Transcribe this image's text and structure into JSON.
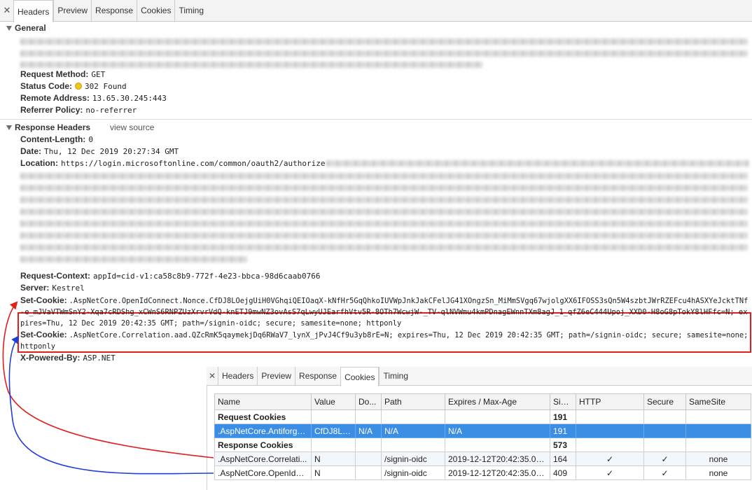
{
  "tabs": [
    "Headers",
    "Preview",
    "Response",
    "Cookies",
    "Timing"
  ],
  "general": {
    "title": "General",
    "rows": [
      {
        "key": "Request Method:",
        "value": "GET"
      },
      {
        "key": "Status Code:",
        "value": "302 Found"
      },
      {
        "key": "Remote Address:",
        "value": "13.65.30.245:443"
      },
      {
        "key": "Referrer Policy:",
        "value": "no-referrer"
      }
    ]
  },
  "response_headers": {
    "title": "Response Headers",
    "view_source": "view source",
    "content_length": {
      "key": "Content-Length:",
      "value": "0"
    },
    "date": {
      "key": "Date:",
      "value": "Thu, 12 Dec 2019 20:27:34 GMT"
    },
    "location": {
      "key": "Location:",
      "value": "https://login.microsoftonline.com/common/oauth2/authorize"
    },
    "request_context": {
      "key": "Request-Context:",
      "value": "appId=cid-v1:ca58c8b9-772f-4e23-bbca-98d6caab0766"
    },
    "server": {
      "key": "Server:",
      "value": "Kestrel"
    },
    "set_cookie_1": {
      "key": "Set-Cookie:",
      "value": ".AspNetCore.OpenIdConnect.Nonce.CfDJ8LOejgUiH0VGhqiQEIOaqX-kNfHr5GqQhkoIUVWpJnkJakCFelJG41XOngzSn_MiMmSVgq67wjolgXX6IFOSS3sQn5W4szbtJWrRZEFcu4hASXYeJcktTNf-e_mJVaVTWmSnY2-Xqa7cRDShg_xCWnS6RNPZUzXrvrVdQ-knETJ9mwNZ3ovAsS7qLwyUJEarfhVtv5R-8OTh7WcwjW-_TV-qlNVWmu4kmPDnagEWnnTXm8agJ_1_qfZ6eC444Upoj_XXD0-H8oG8pTokY8lHFfc=N; expires=Thu, 12 Dec 2019 20:42:35 GMT; path=/signin-oidc; secure; samesite=none; httponly"
    },
    "set_cookie_2": {
      "key": "Set-Cookie:",
      "value": ".AspNetCore.Correlation.aad.QZcRmK5qaymekjDq6RWaV7_lynX_jPvJ4Cf9u3yb8rE=N; expires=Thu, 12 Dec 2019 20:42:35 GMT; path=/signin-oidc; secure; samesite=none; httponly"
    },
    "x_powered_by": {
      "key": "X-Powered-By:",
      "value": "ASP.NET"
    }
  },
  "cookies_panel": {
    "tabs": [
      "Headers",
      "Preview",
      "Response",
      "Cookies",
      "Timing"
    ],
    "columns": [
      "Name",
      "Value",
      "Do...",
      "Path",
      "Expires / Max-Age",
      "Size",
      "HTTP",
      "Secure",
      "SameSite"
    ],
    "request_group": {
      "label": "Request Cookies",
      "size": "191"
    },
    "request_rows": [
      {
        "name": ".AspNetCore.Antiforge...",
        "value": "CfDJ8LO...",
        "domain": "N/A",
        "path": "N/A",
        "expires": "N/A",
        "size": "191",
        "http": "",
        "secure": "",
        "samesite": ""
      }
    ],
    "response_group": {
      "label": "Response Cookies",
      "size": "573"
    },
    "response_rows": [
      {
        "name": ".AspNetCore.Correlati...",
        "value": "N",
        "domain": "",
        "path": "/signin-oidc",
        "expires": "2019-12-12T20:42:35.000Z",
        "size": "164",
        "http": "✓",
        "secure": "✓",
        "samesite": "none"
      },
      {
        "name": ".AspNetCore.OpenIdC...",
        "value": "N",
        "domain": "",
        "path": "/signin-oidc",
        "expires": "2019-12-12T20:42:35.000Z",
        "size": "409",
        "http": "✓",
        "secure": "✓",
        "samesite": "none"
      }
    ]
  },
  "colors": {
    "highlight_box": "#e02020",
    "arrow_red": "#e02020",
    "arrow_blue": "#1f3fd6",
    "selected_row": "#3b8ee3"
  }
}
